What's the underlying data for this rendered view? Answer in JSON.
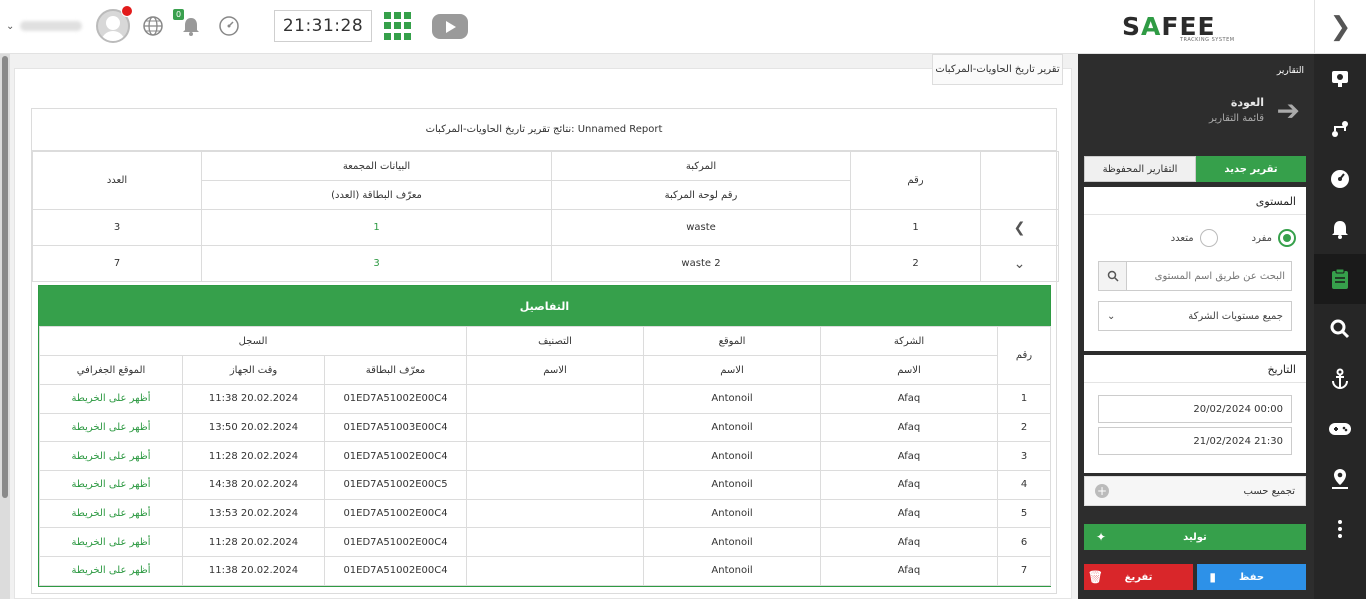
{
  "topbar": {
    "clock": "21:31:28",
    "notif_count": "0",
    "logo": {
      "brand_left": "S",
      "brand_mid": "A",
      "brand_right": "FEE",
      "tagline": "TRACKING SYSTEM"
    }
  },
  "panel": {
    "header": "التقارير",
    "back_title": "العودة",
    "back_sub": "قائمة التقارير",
    "tab_new": "تقرير جديد",
    "tab_saved": "التقارير المحفوظة",
    "level_title": "المستوى",
    "radio_single": "مفرد",
    "radio_multi": "متعدد",
    "search_placeholder": "البحث عن طريق اسم المستوى",
    "select_value": "جميع مستويات الشركة",
    "date_title": "التاريخ",
    "date_from": "20/02/2024 00:00",
    "date_to": "21/02/2024 21:30",
    "group_by": "تجميع حسب",
    "btn_generate": "توليد",
    "btn_save": "حفظ",
    "btn_clear": "تفريغ"
  },
  "report": {
    "tab_title": "تقرير تاريخ الحاويات-المركبات",
    "results_title": "نتائج تقرير تاريخ الحاويات-المركبات: Unnamed Report",
    "outer_headers": {
      "num": "رقم",
      "vehicle": "المركبة",
      "aggregated": "البيانات المجمعة",
      "count": "العدد",
      "plate": "رقم لوحة المركبة",
      "card_id_count": "معرّف البطاقة (العدد)"
    },
    "rows": [
      {
        "num": "1",
        "plate": "waste",
        "cards": "1",
        "count": "3"
      },
      {
        "num": "2",
        "plate": "waste 2",
        "cards": "3",
        "count": "7"
      }
    ],
    "details": {
      "title": "التفاصيل",
      "h_num": "رقم",
      "h_company": "الشركة",
      "h_location": "الموقع",
      "h_category": "التصنيف",
      "h_log": "السجل",
      "h_name": "الاسم",
      "h_card": "معرّف البطاقة",
      "h_device_time": "وقت الجهاز",
      "h_geo": "الموقع الجغرافي",
      "rows": [
        {
          "num": "1",
          "company": "Afaq",
          "location": "Antonoil",
          "category": "",
          "card": "01ED7A51002E00C4",
          "time": "20.02.2024 11:38",
          "geo": "أظهر على الخريطة"
        },
        {
          "num": "2",
          "company": "Afaq",
          "location": "Antonoil",
          "category": "",
          "card": "01ED7A51003E00C4",
          "time": "20.02.2024 13:50",
          "geo": "أظهر على الخريطة"
        },
        {
          "num": "3",
          "company": "Afaq",
          "location": "Antonoil",
          "category": "",
          "card": "01ED7A51002E00C4",
          "time": "20.02.2024 11:28",
          "geo": "أظهر على الخريطة"
        },
        {
          "num": "4",
          "company": "Afaq",
          "location": "Antonoil",
          "category": "",
          "card": "01ED7A51002E00C5",
          "time": "20.02.2024 14:38",
          "geo": "أظهر على الخريطة"
        },
        {
          "num": "5",
          "company": "Afaq",
          "location": "Antonoil",
          "category": "",
          "card": "01ED7A51002E00C4",
          "time": "20.02.2024 13:53",
          "geo": "أظهر على الخريطة"
        },
        {
          "num": "6",
          "company": "Afaq",
          "location": "Antonoil",
          "category": "",
          "card": "01ED7A51002E00C4",
          "time": "20.02.2024 11:28",
          "geo": "أظهر على الخريطة"
        },
        {
          "num": "7",
          "company": "Afaq",
          "location": "Antonoil",
          "category": "",
          "card": "01ED7A51002E00C4",
          "time": "20.02.2024 11:38",
          "geo": "أظهر على الخريطة"
        }
      ]
    }
  },
  "colors": {
    "accent": "#36a04b",
    "save": "#2d91e8",
    "clear": "#d9262a",
    "sidebar": "#262626"
  }
}
